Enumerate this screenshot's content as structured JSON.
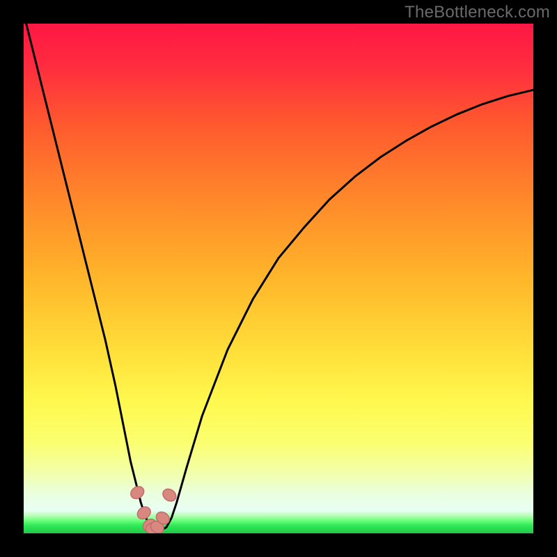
{
  "watermark": "TheBottleneck.com",
  "colors": {
    "black": "#000000",
    "curve": "#000000",
    "marker_fill": "#d98880",
    "marker_stroke": "#c06c6c",
    "green_band": "#2ee856",
    "gradient_stops": [
      {
        "offset": 0.0,
        "color": "#ff1744"
      },
      {
        "offset": 0.08,
        "color": "#ff2b3f"
      },
      {
        "offset": 0.2,
        "color": "#ff5a2e"
      },
      {
        "offset": 0.35,
        "color": "#ff8a2a"
      },
      {
        "offset": 0.5,
        "color": "#ffb62a"
      },
      {
        "offset": 0.65,
        "color": "#ffe13a"
      },
      {
        "offset": 0.74,
        "color": "#fff84e"
      },
      {
        "offset": 0.82,
        "color": "#fbff6e"
      },
      {
        "offset": 0.88,
        "color": "#f2ffa8"
      },
      {
        "offset": 0.92,
        "color": "#eaffdc"
      },
      {
        "offset": 0.955,
        "color": "#e8fff4"
      },
      {
        "offset": 0.965,
        "color": "#b8ffb8"
      },
      {
        "offset": 0.975,
        "color": "#6cff7c"
      },
      {
        "offset": 0.985,
        "color": "#2ee856"
      },
      {
        "offset": 1.0,
        "color": "#23c74a"
      }
    ]
  },
  "chart_data": {
    "type": "line",
    "title": "",
    "xlabel": "",
    "ylabel": "",
    "xlim": [
      0,
      100
    ],
    "ylim": [
      0,
      100
    ],
    "series": [
      {
        "name": "bottleneck-curve",
        "x": [
          0,
          2,
          4,
          6,
          8,
          10,
          12,
          14,
          16,
          18,
          20,
          21,
          22,
          23,
          24,
          25,
          26,
          27,
          28,
          29,
          30,
          32,
          35,
          40,
          45,
          50,
          55,
          60,
          65,
          70,
          75,
          80,
          85,
          90,
          95,
          100
        ],
        "y": [
          102,
          94,
          86,
          78,
          70,
          62,
          54,
          46,
          38,
          29,
          19,
          14,
          10,
          6,
          3,
          1.2,
          0.6,
          0.6,
          1.2,
          3,
          6,
          13,
          23,
          36,
          46,
          54,
          60,
          65.5,
          70,
          73.8,
          77,
          79.8,
          82.2,
          84.2,
          85.8,
          87
        ]
      }
    ],
    "markers": {
      "name": "highlight-dots",
      "x": [
        22.3,
        23.6,
        24.7,
        25.3,
        26.2,
        27.3,
        28.6
      ],
      "y": [
        8.0,
        4.0,
        1.6,
        0.9,
        1.2,
        3.0,
        7.5
      ]
    }
  }
}
